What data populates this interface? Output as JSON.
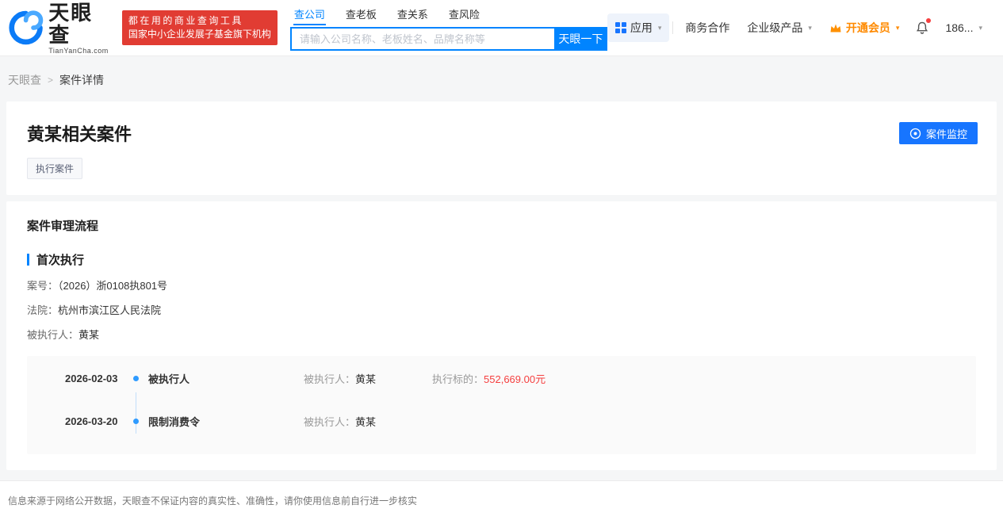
{
  "colors": {
    "primary_blue": "#0084ff",
    "button_blue": "#1775ff",
    "badge_red": "#e13c33",
    "vip_orange": "#ff8a00",
    "amount_red": "#f53f3f"
  },
  "header": {
    "brand": "天眼查",
    "brand_domain": "TianYanCha.com",
    "badge": {
      "line1": "都在用的商业查询工具",
      "line2": "国家中小企业发展子基金旗下机构"
    },
    "tabs": [
      {
        "label": "查公司",
        "active": true
      },
      {
        "label": "查老板",
        "active": false
      },
      {
        "label": "查关系",
        "active": false
      },
      {
        "label": "查风险",
        "active": false
      }
    ],
    "search": {
      "placeholder": "请输入公司名称、老板姓名、品牌名称等",
      "button_label": "天眼一下"
    },
    "nav": {
      "apps": "应用",
      "cooperation": "商务合作",
      "enterprise": "企业级产品",
      "vip": "开通会员",
      "account": "186..."
    }
  },
  "breadcrumb": {
    "home": "天眼查",
    "separator": ">",
    "current": "案件详情"
  },
  "case_card": {
    "title": "黄某相关案件",
    "tag": "执行案件",
    "monitor_button": "案件监控"
  },
  "process_card": {
    "section_title": "案件审理流程",
    "stage_title": "首次执行",
    "fields": [
      {
        "label": "案号：",
        "value": "（2026）浙0108执801号"
      },
      {
        "label": "法院：",
        "value": "杭州市滨江区人民法院"
      },
      {
        "label": "被执行人：",
        "value": "黄某"
      }
    ],
    "timeline": [
      {
        "date": "2026-02-03",
        "title": "被执行人",
        "party_label": "被执行人：",
        "party": "黄某",
        "amount_label": "执行标的：",
        "amount": "552,669.00元"
      },
      {
        "date": "2026-03-20",
        "title": "限制消费令",
        "party_label": "被执行人：",
        "party": "黄某",
        "amount_label": "",
        "amount": ""
      }
    ]
  },
  "footer": {
    "disclaimer": "信息来源于网络公开数据，天眼查不保证内容的真实性、准确性，请你使用信息前自行进一步核实"
  }
}
